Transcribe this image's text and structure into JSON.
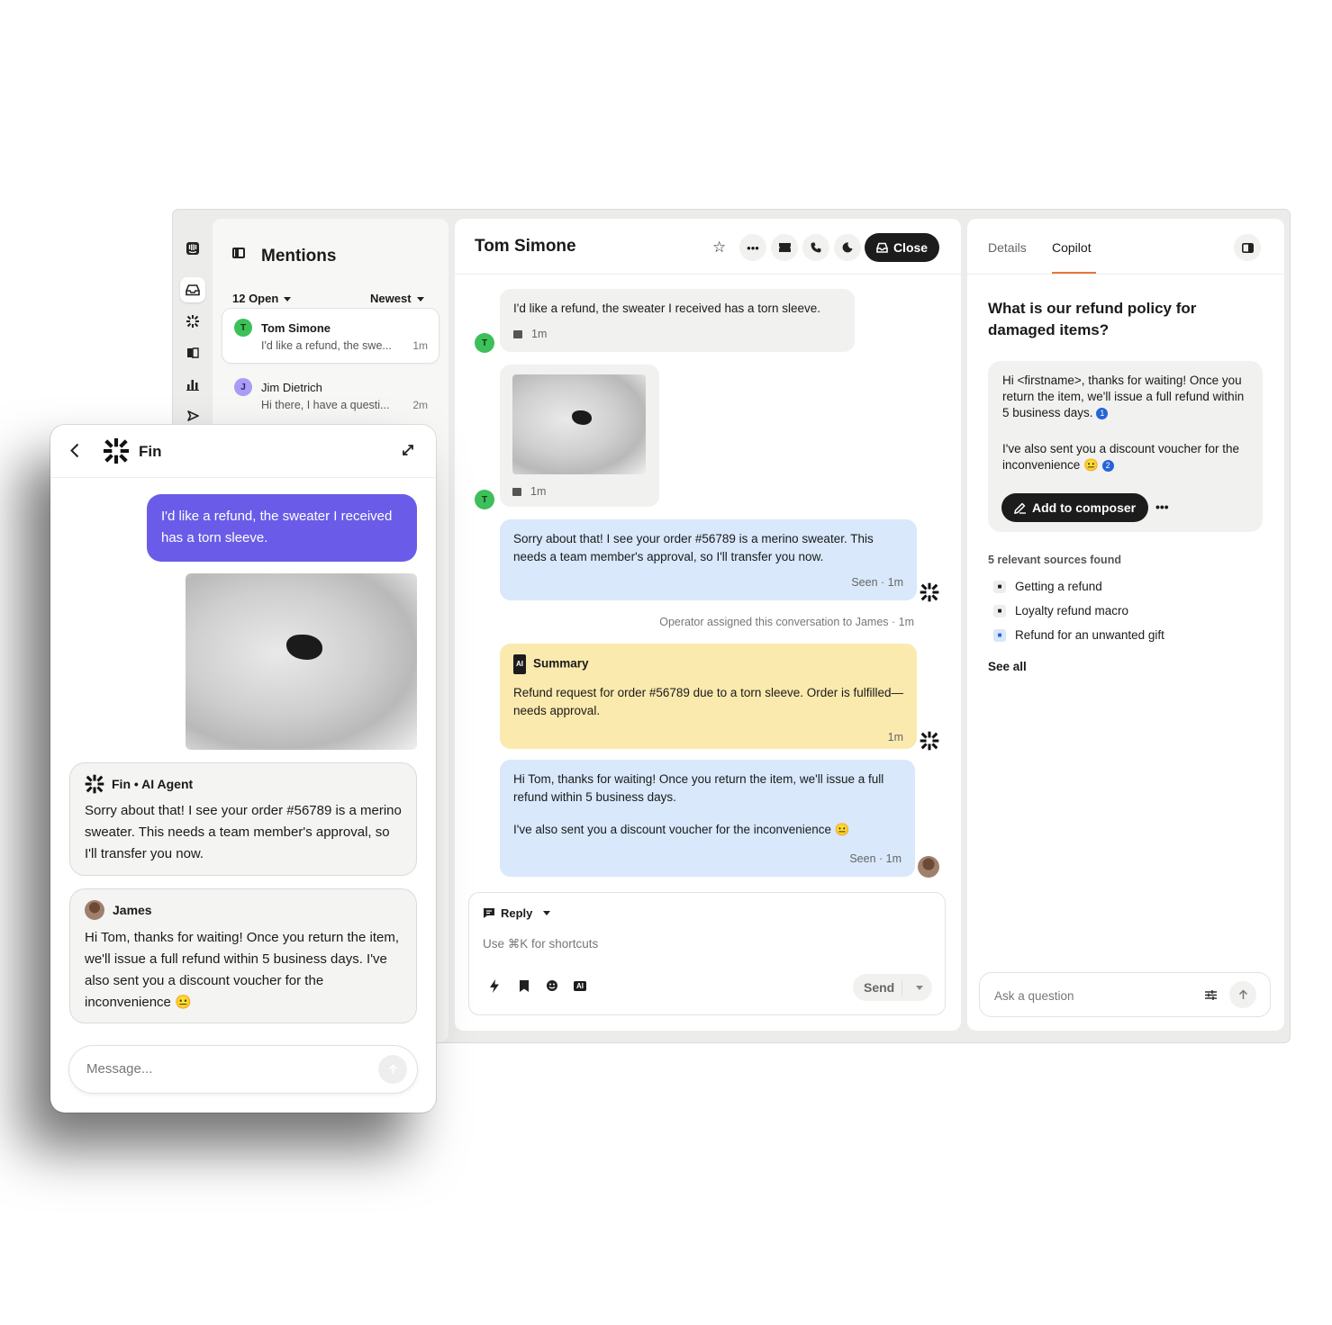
{
  "inbox": {
    "title": "Mentions",
    "filter_open": "12 Open",
    "filter_sort": "Newest",
    "conversations": [
      {
        "initial": "T",
        "name": "Tom Simone",
        "preview": "I'd like a refund, the swe...",
        "time": "1m"
      },
      {
        "initial": "J",
        "name": "Jim Dietrich",
        "preview": "Hi there, I have a questi...",
        "time": "2m"
      }
    ]
  },
  "conversation": {
    "title": "Tom Simone",
    "close_label": "Close",
    "messages": {
      "m1_text": "I'd like a refund, the sweater I received has a torn sleeve.",
      "m1_time": "1m",
      "m2_time": "1m",
      "m3_text": "Sorry about that! I see your order #56789 is a merino sweater. This needs a team member's approval, so I'll transfer you now.",
      "m3_meta": "Seen · 1m",
      "assign_note": "Operator assigned this conversation to James · 1m",
      "summary_label": "Summary",
      "summary_badge": "AI",
      "summary_text": "Refund request for order #56789 due to a torn sleeve. Order is fulfilled—needs approval.",
      "summary_time": "1m",
      "m4_text_1": "Hi Tom, thanks for waiting! Once you return the item, we'll issue a full refund within 5 business days.",
      "m4_text_2": "I've also sent you a discount voucher for the inconvenience 😐",
      "m4_meta": "Seen · 1m",
      "customer_initial": "T"
    },
    "composer": {
      "mode": "Reply",
      "placeholder": "Use ⌘K for shortcuts",
      "send_label": "Send",
      "ai_badge": "AI"
    }
  },
  "side": {
    "tab_details": "Details",
    "tab_copilot": "Copilot",
    "question": "What is our refund policy for damaged items?",
    "answer_1": "Hi <firstname>, thanks for waiting! Once you return the item, we'll issue a full refund within 5 business days.",
    "answer_2": "I've also sent you a discount voucher for the inconvenience 😐",
    "cite_1": "1",
    "cite_2": "2",
    "add_button": "Add to composer",
    "sources_label": "5 relevant sources found",
    "sources": [
      "Getting a refund",
      "Loyalty refund macro",
      "Refund for an unwanted gift"
    ],
    "see_all": "See all",
    "ask_placeholder": "Ask a question"
  },
  "messenger": {
    "title": "Fin",
    "user_msg": "I'd like a refund, the sweater I received has a torn sleeve.",
    "fin_label": "Fin • AI Agent",
    "fin_msg": "Sorry about that! I see your order #56789 is a merino sweater. This needs a team member's approval, so I'll transfer you now.",
    "agent_name": "James",
    "agent_msg": "Hi Tom, thanks for waiting! Once you return the item, we'll issue a full refund within 5 business days. I've also sent you a discount voucher for the inconvenience 😐",
    "input_placeholder": "Message..."
  },
  "colors": {
    "user_bubble": "#6a5ce8",
    "accent_tab": "#e8763a",
    "agent_bubble": "#d9e8fb",
    "summary_bubble": "#fbeaae",
    "close_button": "#1c1c1c"
  }
}
